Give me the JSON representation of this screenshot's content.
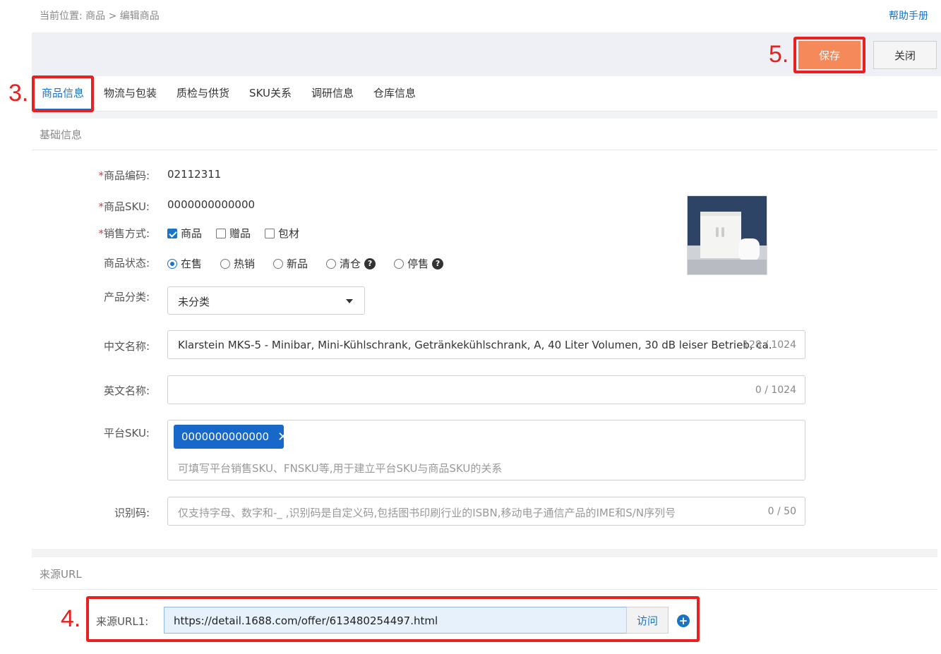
{
  "breadcrumb": {
    "prefix": "当前位置:",
    "path": "商品 > 编辑商品"
  },
  "help_link": "帮助手册",
  "toolbar": {
    "save_label": "保存",
    "close_label": "关闭"
  },
  "tabs": [
    {
      "label": "商品信息",
      "active": true
    },
    {
      "label": "物流与包装"
    },
    {
      "label": "质检与供货"
    },
    {
      "label": "SKU关系"
    },
    {
      "label": "调研信息"
    },
    {
      "label": "仓库信息"
    }
  ],
  "basic": {
    "title": "基础信息",
    "code_label": "商品编码:",
    "code_value": "02112311",
    "sku_label": "商品SKU:",
    "sku_value": "0000000000000",
    "sale_label": "销售方式:",
    "sale_options": [
      {
        "label": "商品",
        "checked": true
      },
      {
        "label": "赠品",
        "checked": false
      },
      {
        "label": "包材",
        "checked": false
      }
    ],
    "status_label": "商品状态:",
    "status_options": [
      {
        "label": "在售",
        "selected": true
      },
      {
        "label": "热销"
      },
      {
        "label": "新品"
      },
      {
        "label": "清仓",
        "help": true
      },
      {
        "label": "停售",
        "help": true
      }
    ],
    "category_label": "产品分类:",
    "category_value": "未分类",
    "cn_name_label": "中文名称:",
    "cn_name_value": "Klarstein MKS-5 - Minibar, Mini-Kühlschrank, Getränkekühlschrank, A, 40 Liter Volumen, 30 dB leiser Betrieb, ca.",
    "cn_name_count": "128 / 1024",
    "en_name_label": "英文名称:",
    "en_name_value": "",
    "en_name_count": "0 / 1024",
    "platform_sku_label": "平台SKU:",
    "platform_sku_tag": "0000000000000",
    "platform_sku_placeholder": "可填写平台销售SKU、FNSKU等,用于建立平台SKU与商品SKU的关系",
    "ident_label": "识别码:",
    "ident_placeholder": "仅支持字母、数字和-_ ,识别码是自定义码,包括图书印刷行业的ISBN,移动电子通信产品的IME和S/N序列号",
    "ident_count": "0 / 50"
  },
  "source": {
    "title": "来源URL",
    "url1_label": "来源URL1:",
    "url1_value": "https://detail.1688.com/offer/613480254497.html",
    "visit_label": "访问"
  },
  "annotations": {
    "a3": "3.",
    "a4": "4.",
    "a5": "5."
  },
  "colors": {
    "accent": "#1a73c7",
    "save": "#f5895a",
    "highlight": "#e8201f",
    "tag": "#1768c9"
  }
}
